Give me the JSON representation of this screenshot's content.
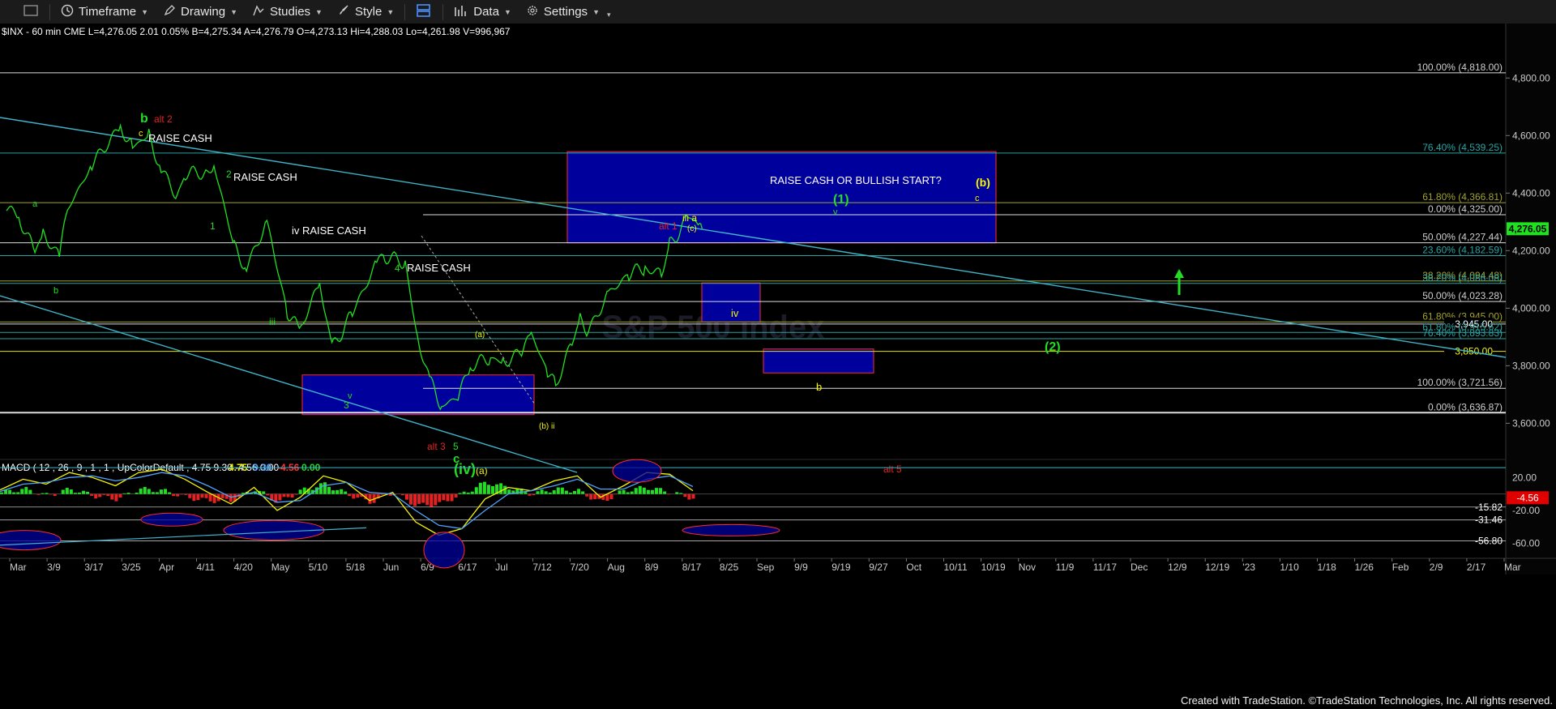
{
  "toolbar": {
    "items": [
      {
        "label": "",
        "icon": "window-icon"
      },
      {
        "label": "Timeframe",
        "icon": "clock-icon"
      },
      {
        "label": "Drawing",
        "icon": "pencil-icon"
      },
      {
        "label": "Studies",
        "icon": "studies-icon"
      },
      {
        "label": "Style",
        "icon": "brush-icon"
      },
      {
        "label": "",
        "icon": "layout-icon"
      },
      {
        "label": "Data",
        "icon": "bar-chart-icon"
      },
      {
        "label": "Settings",
        "icon": "gear-icon"
      }
    ]
  },
  "info_line": "$INX - 60 min  CME  L=4,276.05  2.01   0.05%  B=4,275.34  A=4,276.79  O=4,273.13  Hi=4,288.03  Lo=4,261.98  V=996,967",
  "watermark": "S&P 500 Index",
  "footer": "Created with TradeStation. ©TradeStation Technologies, Inc. All rights reserved.",
  "chart_data": [
    {
      "type": "line",
      "name": "price",
      "y_axis_ticks": [
        4800,
        4600,
        4400,
        4200,
        4000,
        3800,
        3600
      ],
      "y_axis_labels": [
        "4,800.00",
        "4,600.00",
        "4,400.00",
        "4,200.00",
        "4,000.00",
        "3,800.00",
        "3,600.00"
      ],
      "ylim": [
        3480,
        4950
      ],
      "last_price": "4,276.05",
      "x_ticks": [
        "Mar",
        "3/9",
        "3/17",
        "3/25",
        "Apr",
        "4/11",
        "4/20",
        "May",
        "5/10",
        "5/18",
        "Jun",
        "6/9",
        "6/17",
        "Jul",
        "7/12",
        "7/20",
        "Aug",
        "8/9",
        "8/17",
        "8/25",
        "Sep",
        "9/9",
        "9/19",
        "9/27",
        "Oct",
        "10/11",
        "10/19",
        "Nov",
        "11/9",
        "11/17",
        "Dec",
        "12/9",
        "12/19",
        "'23",
        "1/10",
        "1/18",
        "1/26",
        "Feb",
        "2/9",
        "2/17",
        "Mar"
      ],
      "series": [
        {
          "color": "#1fe11f",
          "values": [
            [
              "3/1",
              4350
            ],
            [
              "3/4",
              4320
            ],
            [
              "3/8",
              4190
            ],
            [
              "3/10",
              4260
            ],
            [
              "3/14",
              4180
            ],
            [
              "3/16",
              4340
            ],
            [
              "3/22",
              4500
            ],
            [
              "3/29",
              4630
            ],
            [
              "4/1",
              4560
            ],
            [
              "4/5",
              4600
            ],
            [
              "4/8",
              4480
            ],
            [
              "4/12",
              4390
            ],
            [
              "4/14",
              4470
            ],
            [
              "4/19",
              4470
            ],
            [
              "4/21",
              4500
            ],
            [
              "4/26",
              4210
            ],
            [
              "4/29",
              4140
            ],
            [
              "5/4",
              4300
            ],
            [
              "5/9",
              3990
            ],
            [
              "5/12",
              3920
            ],
            [
              "5/17",
              4090
            ],
            [
              "5/20",
              3860
            ],
            [
              "5/25",
              3980
            ],
            [
              "5/31",
              4160
            ],
            [
              "6/2",
              4180
            ],
            [
              "6/7",
              4160
            ],
            [
              "6/10",
              3900
            ],
            [
              "6/13",
              3750
            ],
            [
              "6/16",
              3660
            ],
            [
              "6/20",
              3690
            ],
            [
              "6/23",
              3800
            ],
            [
              "6/28",
              3830
            ],
            [
              "7/1",
              3810
            ],
            [
              "7/6",
              3850
            ],
            [
              "7/8",
              3910
            ],
            [
              "7/12",
              3780
            ],
            [
              "7/14",
              3730
            ],
            [
              "7/18",
              3880
            ],
            [
              "7/20",
              3960
            ],
            [
              "7/22",
              3920
            ],
            [
              "7/27",
              4050
            ],
            [
              "8/1",
              4120
            ],
            [
              "8/5",
              4140
            ],
            [
              "8/9",
              4120
            ],
            [
              "8/11",
              4220
            ],
            [
              "8/16",
              4320
            ],
            [
              "8/18",
              4280
            ],
            [
              "8/19",
              4276
            ]
          ]
        }
      ],
      "horizontal_levels": [
        {
          "label": "100.00% (4,818.00)",
          "value": 4818,
          "color": "#dddddd"
        },
        {
          "label": "76.40% (4,539.25)",
          "value": 4539.25,
          "color": "#29a3a3"
        },
        {
          "label": "61.80% (4,366.81)",
          "value": 4366.81,
          "color": "#a3a32a"
        },
        {
          "label": "0.00% (4,325.00)",
          "value": 4325,
          "color": "#dddddd"
        },
        {
          "label": "50.00% (4,227.44)",
          "value": 4227.44,
          "color": "#dddddd"
        },
        {
          "label": "23.60% (4,182.59)",
          "value": 4182.59,
          "color": "#29a3a3"
        },
        {
          "label": "38.20% (4,094.48)",
          "value": 4094.48,
          "color": "#a3a32a"
        },
        {
          "label": "38.20% (4,086.08)",
          "value": 4086.08,
          "color": "#29a3a3"
        },
        {
          "label": "50.00% (4,023.28)",
          "value": 4023.28,
          "color": "#dddddd"
        },
        {
          "label": "61.80% (3,945.00)",
          "value": 3952,
          "color": "#a3a32a"
        },
        {
          "label": "3,945.00",
          "value": 3945,
          "color": "#dddddd"
        },
        {
          "label": "61.80% (3,915.62)",
          "value": 3915.62,
          "color": "#29a3a3"
        },
        {
          "label": "76.40% (3,893.83)",
          "value": 3893.83,
          "color": "#29a3a3"
        },
        {
          "label": "3,850.00",
          "value": 3850,
          "color": "#e5e500"
        },
        {
          "label": "100.00% (3,721.56)",
          "value": 3721.56,
          "color": "#dddddd"
        },
        {
          "label": "0.00% (3,636.87)",
          "value": 3636.87,
          "color": "#dddddd"
        }
      ],
      "annotations": [
        {
          "text": "RAISE CASH",
          "color": "#ffffff"
        },
        {
          "text": "RAISE CASH",
          "color": "#ffffff"
        },
        {
          "text": "iv RAISE CASH",
          "color": "#ffffff"
        },
        {
          "text": "RAISE CASH",
          "color": "#ffffff"
        },
        {
          "text": "RAISE CASH OR BULLISH START?",
          "color": "#ffffff"
        },
        {
          "text": "(1)",
          "color": "#22dd22"
        },
        {
          "text": "(2)",
          "color": "#22dd22"
        },
        {
          "text": "(b)",
          "color": "#f5f500"
        },
        {
          "text": "iv",
          "color": "#f5f500"
        },
        {
          "text": "b",
          "color": "#f5f500"
        },
        {
          "text": "(iv)",
          "color": "#22dd22"
        },
        {
          "text": "(a)",
          "color": "#f5f500"
        },
        {
          "text": "alt 3",
          "color": "#e52222"
        },
        {
          "text": "alt 5",
          "color": "#e52222"
        },
        {
          "text": "alt 2",
          "color": "#e52222"
        },
        {
          "text": "alt 1",
          "color": "#e52222"
        }
      ]
    },
    {
      "type": "line",
      "name": "MACD",
      "title": "MACD ( 12 , 26 , 9 , 1 , 1 , UpColorDefault , 4.75  9.30  -4.56  0.00",
      "legend_values": [
        {
          "text": "4.75",
          "color": "#f5f500"
        },
        {
          "text": "9.30",
          "color": "#4fa3ff"
        },
        {
          "text": "-4.56",
          "color": "#ff3333"
        },
        {
          "text": "0.00",
          "color": "#22dd22"
        }
      ],
      "y_axis_ticks": [
        20,
        -20,
        -60
      ],
      "y_axis_labels": [
        "20.00",
        "-20.00",
        "-60.00"
      ],
      "ylim": [
        -78,
        40
      ],
      "reference_levels": [
        "-15.82",
        "-31.46",
        "-56.80"
      ],
      "last_value": "-4.56",
      "series": [
        {
          "name": "MACD",
          "color": "#f5f500",
          "values": [
            5,
            18,
            12,
            26,
            20,
            10,
            26,
            30,
            18,
            2,
            -12,
            8,
            -20,
            -4,
            22,
            14,
            -8,
            2,
            -34,
            -50,
            -42,
            -6,
            8,
            4,
            16,
            22,
            -4,
            10,
            26,
            24,
            4
          ]
        },
        {
          "name": "Signal",
          "color": "#4fa3ff",
          "values": [
            3,
            12,
            14,
            20,
            22,
            16,
            20,
            26,
            22,
            10,
            -4,
            2,
            -10,
            -8,
            10,
            14,
            2,
            0,
            -20,
            -38,
            -42,
            -20,
            0,
            4,
            10,
            18,
            6,
            6,
            18,
            22,
            9
          ]
        }
      ]
    }
  ]
}
